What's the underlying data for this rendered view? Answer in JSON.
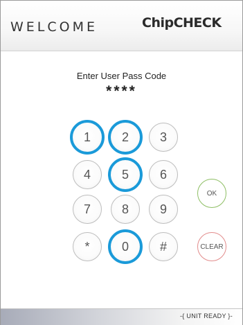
{
  "header": {
    "welcome": "WELCOME",
    "logo": "ChipCHECK"
  },
  "prompt": "Enter User Pass Code",
  "passcode_mask": "****",
  "keypad": {
    "k1": "1",
    "k2": "2",
    "k3": "3",
    "k4": "4",
    "k5": "5",
    "k6": "6",
    "k7": "7",
    "k8": "8",
    "k9": "9",
    "kstar": "*",
    "k0": "0",
    "khash": "#"
  },
  "actions": {
    "ok": "OK",
    "clear": "CLEAR"
  },
  "footer": {
    "status": "-{ UNIT READY }-"
  },
  "colors": {
    "highlight": "#1a9ad9",
    "ok_border": "#8dbe63",
    "clear_border": "#e28b8b"
  }
}
